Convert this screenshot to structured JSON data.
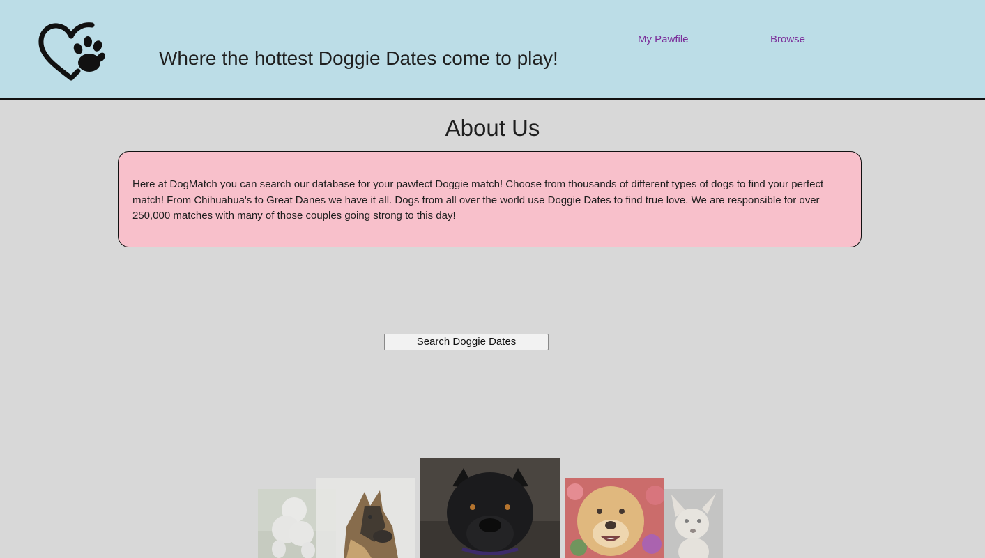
{
  "header": {
    "logo_icon": "heart-paw-icon",
    "tagline": "Where the hottest Doggie Dates come to play!",
    "background_color": "#bcdde7",
    "nav": [
      {
        "label": "My Pawfile"
      },
      {
        "label": "Browse"
      }
    ],
    "link_color": "#7b2e9a"
  },
  "about": {
    "title": "About Us",
    "text": "Here at DogMatch you can search our database for your pawfect Doggie match! Choose from thousands of different types of dogs to find your perfect match! From Chihuahua's to Great Danes we have it all. Dogs from all over the world use Doggie Dates to find true love. We are responsible for over 250,000 matches with many of those couples going strong to this day!",
    "box_color": "#f8c0cb"
  },
  "search": {
    "input_value": "",
    "button_label": "Search Doggie Dates"
  },
  "carousel": {
    "images": [
      {
        "subject": "white-poodle"
      },
      {
        "subject": "german-shepherd"
      },
      {
        "subject": "black-pitbull"
      },
      {
        "subject": "golden-retriever"
      },
      {
        "subject": "white-chihuahua"
      }
    ]
  }
}
